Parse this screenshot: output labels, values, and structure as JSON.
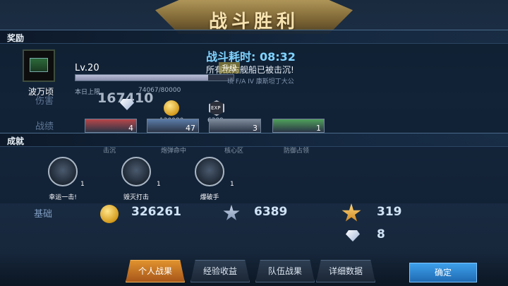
{
  "header": {
    "title": "战斗胜利"
  },
  "rewards": {
    "section_label": "奖励",
    "player_name": "波万顷",
    "level": "Lv.20",
    "xp_progress": 0.84,
    "xp_caption": "本日上限",
    "xp_value": "74067/80000",
    "duration": "战斗耗时: 08:32",
    "sunk_message": "所有敌方舰船已被击沉!",
    "upgrade_tag": "升级",
    "dim_text": "顷  F/A  IV  康斯坦丁大公",
    "damage_label": "伤害",
    "damage_value": "167410",
    "coin_value": "130080",
    "exp_value": "6389",
    "exp_icon_text": "EXP",
    "record_label": "战绩",
    "cards": [
      {
        "count": "4",
        "color": "#b8474a"
      },
      {
        "count": "47",
        "color": "#5b7ca8"
      },
      {
        "count": "3",
        "color": "#7f8c9c"
      },
      {
        "count": "1",
        "color": "#4fa05a"
      }
    ],
    "card_captions": [
      "击沉",
      "炮弹命中",
      "核心区",
      "防御占领"
    ]
  },
  "achievements": {
    "section_label": "成就",
    "items": [
      {
        "name": "幸运一击!",
        "count": "1",
        "icon": "lucky-strike-icon"
      },
      {
        "name": "毁灭打击",
        "count": "1",
        "icon": "devastating-strike-icon"
      },
      {
        "name": "爆破手",
        "count": "1",
        "icon": "demolisher-icon"
      }
    ]
  },
  "base": {
    "label": "基础",
    "coins": "326261",
    "xp": "6389",
    "commander_xp": "319",
    "gems": "8"
  },
  "tabs": [
    {
      "label": "个人战果",
      "active": true
    },
    {
      "label": "经验收益",
      "active": false
    },
    {
      "label": "队伍战果",
      "active": false
    },
    {
      "label": "详细数据",
      "active": false
    }
  ],
  "confirm_label": "确定"
}
